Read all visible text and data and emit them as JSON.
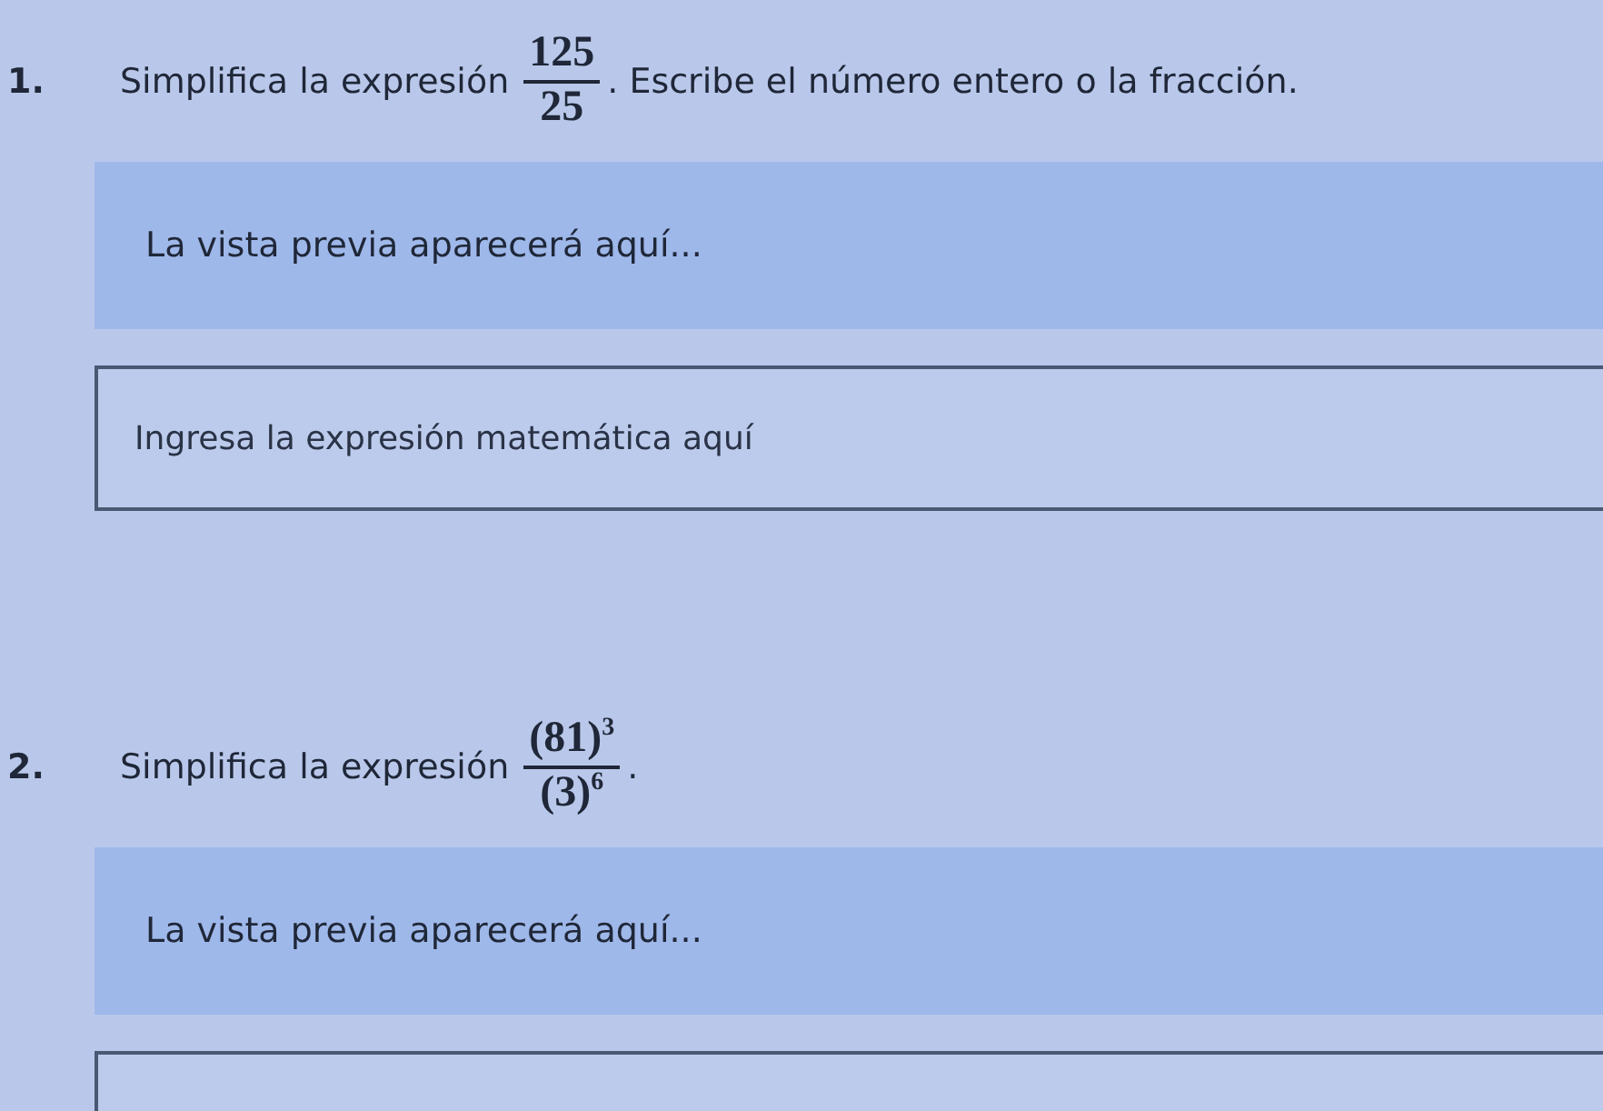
{
  "questions": [
    {
      "number": "1.",
      "prompt_before": "Simplifica la expresión",
      "numerator": "125",
      "denominator": "25",
      "prompt_after": ". Escribe el número entero o la fracción.",
      "preview": "La vista previa aparecerá aquí...",
      "input": {
        "kind": "text",
        "placeholder": "Ingresa la expresión matemática aquí"
      }
    },
    {
      "number": "2.",
      "prompt_before": "Simplifica la expresión",
      "numerator": "(81)$^{3}$",
      "denominator": "(3)$^{6}$",
      "prompt_after": ".",
      "preview": "La vista previa aparecerá aquí...",
      "input": {
        "kind": "text"
      }
    }
  ]
}
